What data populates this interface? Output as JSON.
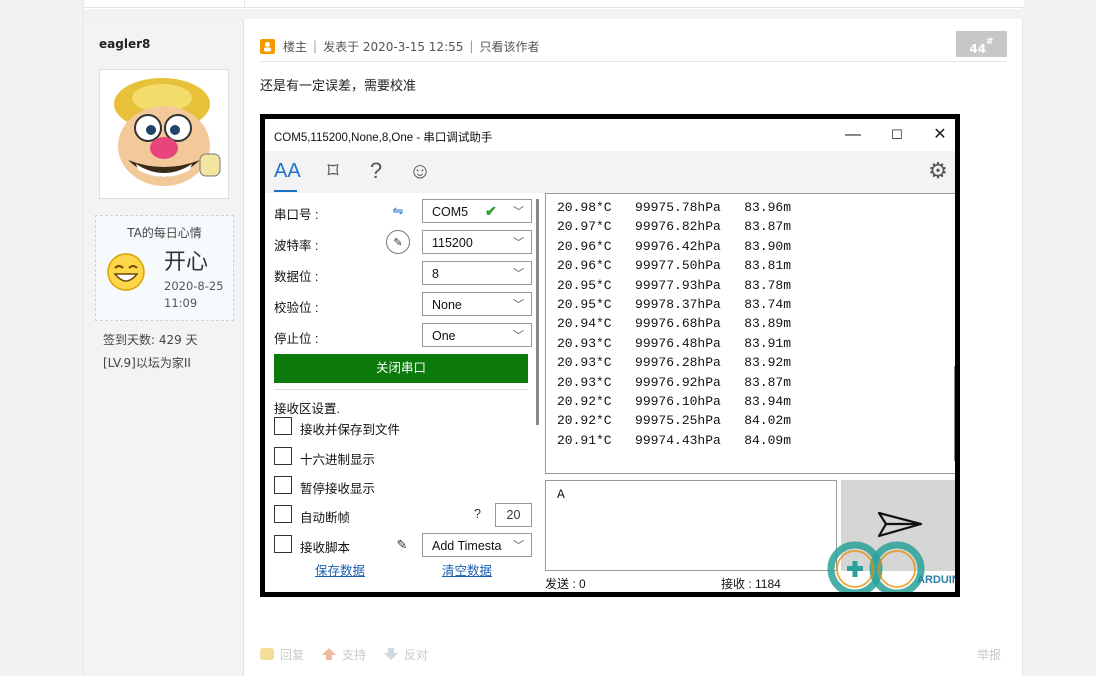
{
  "post": {
    "author": "eagler8",
    "mood": {
      "title": "TA的每日心情",
      "text": "开心",
      "date": "2020-8-25",
      "time": "11:09"
    },
    "sign_days": "签到天数: 429 天",
    "level": "[LV.9]以坛为家II",
    "meta": {
      "role": "楼主",
      "posted": "发表于 2020-3-15 12:55",
      "only_author": "只看该作者"
    },
    "floor": "44",
    "floor_sup": "#",
    "text": "还是有一定误差，需要校准",
    "actions": {
      "reply": "回复",
      "support": "支持",
      "oppose": "反对",
      "report": "举报"
    }
  },
  "serial_tool": {
    "title": "COM5,115200,None,8,One - 串口调试助手",
    "window_controls": {
      "minimize": "—",
      "maximize": "☐",
      "close": "✕"
    },
    "toolbar": {
      "font": "AA",
      "crop": "⌑",
      "help": "?",
      "emoji": "☺",
      "settings": "⚙"
    },
    "fields": [
      {
        "label": "串口号 :",
        "value": "COM5"
      },
      {
        "label": "波特率 :",
        "value": "115200"
      },
      {
        "label": "数据位 :",
        "value": "8"
      },
      {
        "label": "校验位 :",
        "value": "None"
      },
      {
        "label": "停止位 :",
        "value": "One"
      }
    ],
    "close_port": "关闭串口",
    "recv_settings": "接收区设置.",
    "checkboxes": {
      "save_to_file": "接收并保存到文件",
      "hex_display": "十六进制显示",
      "pause_display": "暂停接收显示",
      "auto_frame": "自动断帧",
      "recv_script": "接收脚本"
    },
    "auto_frame_q": "?",
    "auto_frame_value": "20",
    "script_select": "Add Timesta",
    "save_data": "保存数据",
    "clear_data": "清空数据",
    "output_lines": [
      "20.98*C   99975.78hPa   83.96m",
      "20.97*C   99976.82hPa   83.87m",
      "20.96*C   99976.42hPa   83.90m",
      "20.96*C   99977.50hPa   83.81m",
      "20.95*C   99977.93hPa   83.78m",
      "20.95*C   99978.37hPa   83.74m",
      "20.94*C   99976.68hPa   83.89m",
      "20.93*C   99976.48hPa   83.91m",
      "20.93*C   99976.28hPa   83.92m",
      "20.93*C   99976.92hPa   83.87m",
      "20.92*C   99976.10hPa   83.94m",
      "20.92*C   99975.25hPa   84.02m",
      "20.91*C   99974.43hPa   84.09m"
    ],
    "input_text": "A",
    "status": {
      "send": "发送 : 0",
      "recv": "接收 : 1184"
    },
    "watermark": "ARDUINO"
  },
  "colors": {
    "port_button": "#0b7a0b",
    "link": "#1a5fb4",
    "floor_badge": "#c7c7c7",
    "mood_border": "#c9d4dd"
  }
}
